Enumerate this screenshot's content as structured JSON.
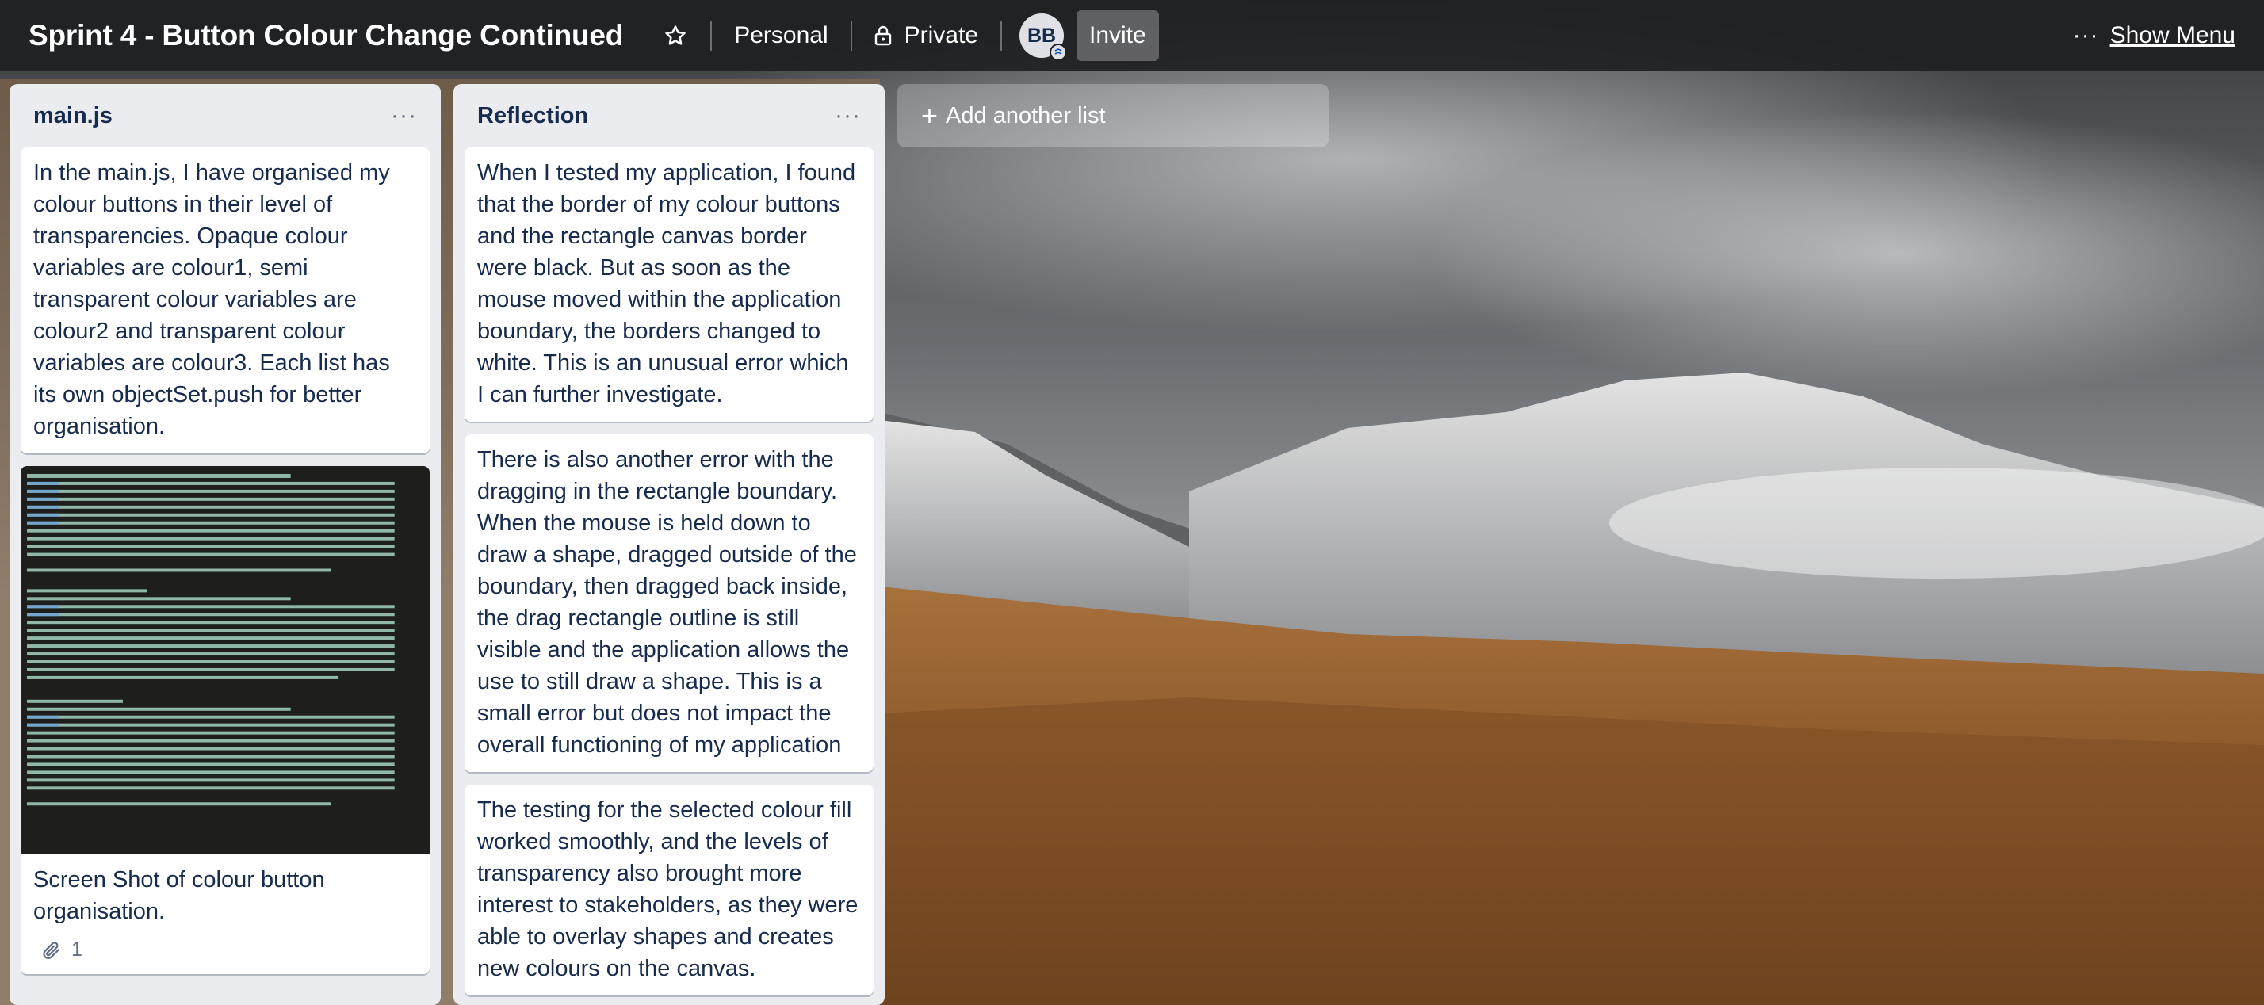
{
  "header": {
    "board_title": "Sprint 4 - Button Colour Change Continued",
    "star_icon": "star-icon",
    "workspace_label": "Personal",
    "visibility_label": "Private",
    "visibility_icon": "lock-icon",
    "member_avatar_initials": "BB",
    "invite_label": "Invite",
    "more_icon": "more-horizontal-icon",
    "more_glyph": "···",
    "show_menu_label": "Show Menu"
  },
  "lists": [
    {
      "title": "main.js",
      "menu_glyph": "···",
      "cards": [
        {
          "text": "In the main.js, I have organised my colour buttons in their level of transparencies. Opaque colour variables are colour1, semi transparent colour variables are colour2 and transparent colour variables are colour3. Each list has its own objectSet.push for better organisation."
        },
        {
          "text": "Screen Shot of colour button organisation.",
          "attachment_icon": "paperclip-icon",
          "attachment_count": "1"
        }
      ]
    },
    {
      "title": "Reflection",
      "menu_glyph": "···",
      "cards": [
        {
          "text": "When I tested my application, I found that the border of my colour buttons and the rectangle canvas border were black. But as soon as the mouse moved within the application boundary, the borders changed to white. This is an unusual error which I can further investigate."
        },
        {
          "text": "There is also another error with the dragging in the rectangle boundary. When the mouse is held down to draw a shape, dragged outside of the boundary, then dragged back inside, the drag rectangle outline is still visible and the application allows the use to still draw a shape. This is a small error but does not impact the overall functioning of my application"
        },
        {
          "text": "The testing for the selected colour fill worked smoothly, and the levels of transparency also brought more interest to stakeholders, as they were able to overlay shapes and creates new colours on the canvas."
        }
      ]
    }
  ],
  "add_list": {
    "icon": "plus-icon",
    "glyph": "+",
    "label": "Add another list"
  },
  "colors": {
    "header_bg": "#1e2022",
    "list_bg": "#ebecf0",
    "card_text": "#172b4d",
    "muted_text": "#5e6c84"
  }
}
